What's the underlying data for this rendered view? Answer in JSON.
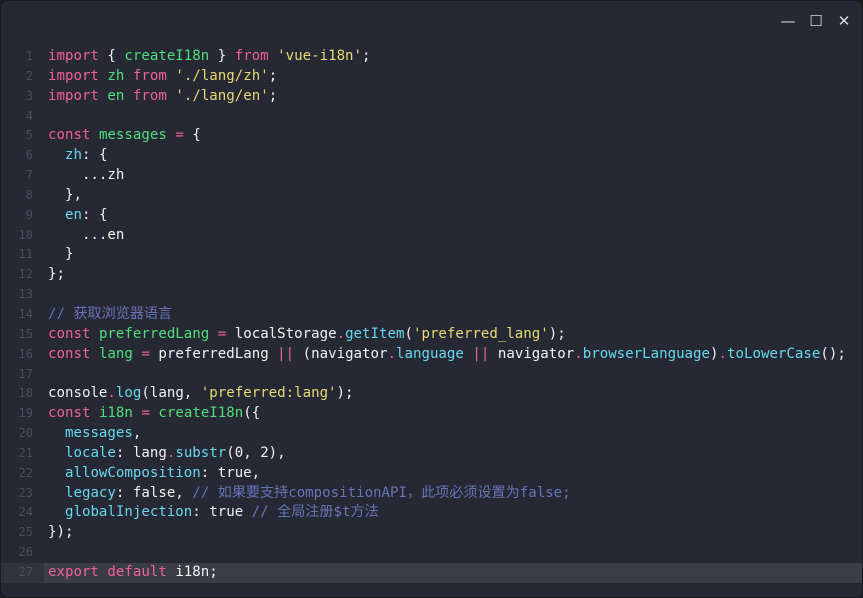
{
  "window": {
    "controls": {
      "minimize": "—",
      "maximize": "☐",
      "close": "✕"
    }
  },
  "current_line": 27,
  "colors": {
    "background": "#262833",
    "keyword": "#f0609c",
    "function": "#4fe07c",
    "string": "#e6db74",
    "property": "#66d9ef",
    "comment": "#6874b8"
  },
  "lines": [
    [
      [
        "import",
        "kw"
      ],
      [
        " { ",
        "pl"
      ],
      [
        "createI18n",
        "fn"
      ],
      [
        " } ",
        "pl"
      ],
      [
        "from",
        "kw"
      ],
      [
        " ",
        "pl"
      ],
      [
        "'vue-i18n'",
        "str"
      ],
      [
        ";",
        "pl"
      ]
    ],
    [
      [
        "import",
        "kw"
      ],
      [
        " ",
        "pl"
      ],
      [
        "zh",
        "fn"
      ],
      [
        " ",
        "pl"
      ],
      [
        "from",
        "kw"
      ],
      [
        " ",
        "pl"
      ],
      [
        "'./lang/zh'",
        "str"
      ],
      [
        ";",
        "pl"
      ]
    ],
    [
      [
        "import",
        "kw"
      ],
      [
        " ",
        "pl"
      ],
      [
        "en",
        "fn"
      ],
      [
        " ",
        "pl"
      ],
      [
        "from",
        "kw"
      ],
      [
        " ",
        "pl"
      ],
      [
        "'./lang/en'",
        "str"
      ],
      [
        ";",
        "pl"
      ]
    ],
    [],
    [
      [
        "const",
        "kw"
      ],
      [
        " ",
        "pl"
      ],
      [
        "messages",
        "fn"
      ],
      [
        " ",
        "pl"
      ],
      [
        "=",
        "op"
      ],
      [
        " {",
        "pl"
      ]
    ],
    [
      [
        "  ",
        "pl"
      ],
      [
        "zh",
        "prop"
      ],
      [
        ": {",
        "pl"
      ]
    ],
    [
      [
        "    ...zh",
        "pl"
      ]
    ],
    [
      [
        "  },",
        "pl"
      ]
    ],
    [
      [
        "  ",
        "pl"
      ],
      [
        "en",
        "prop"
      ],
      [
        ": {",
        "pl"
      ]
    ],
    [
      [
        "    ...en",
        "pl"
      ]
    ],
    [
      [
        "  }",
        "pl"
      ]
    ],
    [
      [
        "};",
        "pl"
      ]
    ],
    [],
    [
      [
        "// 获取浏览器语言",
        "cm"
      ]
    ],
    [
      [
        "const",
        "kw"
      ],
      [
        " ",
        "pl"
      ],
      [
        "preferredLang",
        "fn"
      ],
      [
        " ",
        "pl"
      ],
      [
        "=",
        "op"
      ],
      [
        " localStorage",
        "pl"
      ],
      [
        ".",
        "op"
      ],
      [
        "getItem",
        "prop"
      ],
      [
        "(",
        "pl"
      ],
      [
        "'preferred_lang'",
        "str"
      ],
      [
        ");",
        "pl"
      ]
    ],
    [
      [
        "const",
        "kw"
      ],
      [
        " ",
        "pl"
      ],
      [
        "lang",
        "fn"
      ],
      [
        " ",
        "pl"
      ],
      [
        "=",
        "op"
      ],
      [
        " preferredLang ",
        "pl"
      ],
      [
        "||",
        "op"
      ],
      [
        " (navigator",
        "pl"
      ],
      [
        ".",
        "op"
      ],
      [
        "language",
        "prop"
      ],
      [
        " ",
        "pl"
      ],
      [
        "||",
        "op"
      ],
      [
        " navigator",
        "pl"
      ],
      [
        ".",
        "op"
      ],
      [
        "browserLanguage",
        "prop"
      ],
      [
        ")",
        "pl"
      ],
      [
        ".",
        "op"
      ],
      [
        "toLowerCase",
        "prop"
      ],
      [
        "();",
        "pl"
      ]
    ],
    [],
    [
      [
        "console",
        "pl"
      ],
      [
        ".",
        "op"
      ],
      [
        "log",
        "prop"
      ],
      [
        "(lang, ",
        "pl"
      ],
      [
        "'preferred:lang'",
        "str"
      ],
      [
        ");",
        "pl"
      ]
    ],
    [
      [
        "const",
        "kw"
      ],
      [
        " ",
        "pl"
      ],
      [
        "i18n",
        "fn"
      ],
      [
        " ",
        "pl"
      ],
      [
        "=",
        "op"
      ],
      [
        " ",
        "pl"
      ],
      [
        "createI18n",
        "fn"
      ],
      [
        "({",
        "pl"
      ]
    ],
    [
      [
        "  ",
        "pl"
      ],
      [
        "messages",
        "prop"
      ],
      [
        ",",
        "pl"
      ]
    ],
    [
      [
        "  ",
        "pl"
      ],
      [
        "locale",
        "prop"
      ],
      [
        ": lang",
        "pl"
      ],
      [
        ".",
        "op"
      ],
      [
        "substr",
        "prop"
      ],
      [
        "(0, 2),",
        "pl"
      ]
    ],
    [
      [
        "  ",
        "pl"
      ],
      [
        "allowComposition",
        "prop"
      ],
      [
        ": true,",
        "pl"
      ]
    ],
    [
      [
        "  ",
        "pl"
      ],
      [
        "legacy",
        "prop"
      ],
      [
        ": false, ",
        "pl"
      ],
      [
        "// 如果要支持compositionAPI，此项必须设置为false;",
        "cm"
      ]
    ],
    [
      [
        "  ",
        "pl"
      ],
      [
        "globalInjection",
        "prop"
      ],
      [
        ": true ",
        "pl"
      ],
      [
        "// 全局注册$t方法",
        "cm"
      ]
    ],
    [
      [
        "});",
        "pl"
      ]
    ],
    [],
    [
      [
        "export",
        "kw"
      ],
      [
        " ",
        "pl"
      ],
      [
        "default",
        "kw"
      ],
      [
        " i18n;",
        "pl"
      ]
    ]
  ]
}
